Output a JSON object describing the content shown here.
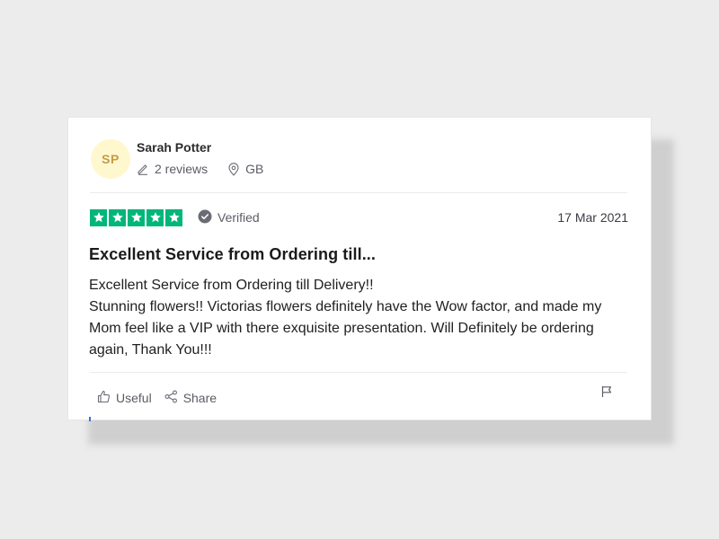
{
  "reviewer": {
    "initials": "SP",
    "name": "Sarah Potter",
    "reviews_count": "2 reviews",
    "country": "GB"
  },
  "rating": {
    "stars": 5,
    "max_stars": 5,
    "verified_label": "Verified",
    "date": "17 Mar 2021"
  },
  "review": {
    "title": "Excellent Service from Ordering till...",
    "body_lines": [
      "Excellent Service from Ordering till Delivery!!",
      "Stunning flowers!! Victorias flowers definitely have the Wow factor, and made my Mom feel like a VIP with there exquisite presentation. Will Definitely be ordering again, Thank You!!!"
    ]
  },
  "actions": {
    "useful_label": "Useful",
    "share_label": "Share"
  },
  "icons": {
    "reviews": "pencil-icon",
    "location": "location-pin-icon",
    "verified": "check-badge-icon",
    "useful": "thumbs-up-icon",
    "share": "share-icon",
    "report": "flag-icon"
  },
  "colors": {
    "star_green": "#00b67a",
    "avatar_bg": "#fff8cf",
    "avatar_text": "#c59a4a"
  }
}
